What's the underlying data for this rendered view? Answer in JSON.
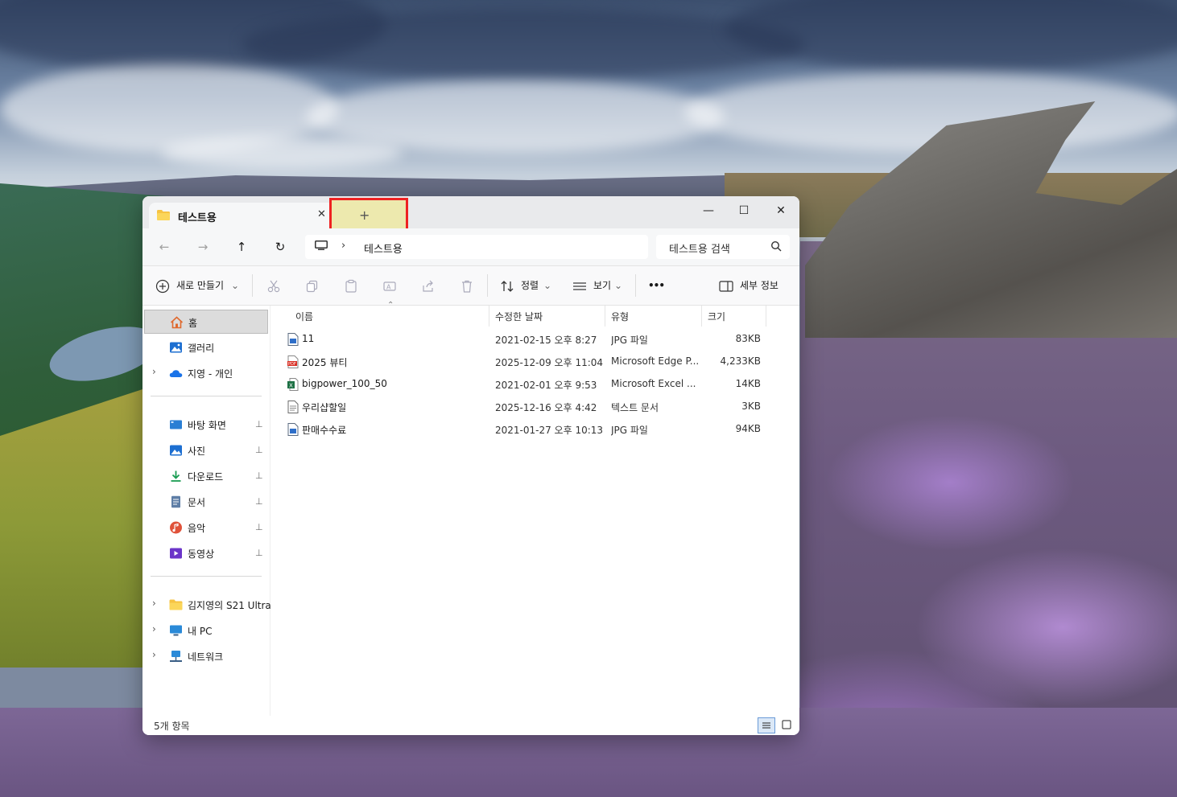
{
  "window": {
    "tab_title": "테스트용",
    "new_tab_label": "+",
    "close_tab_label": "✕",
    "minimize_label": "—",
    "maximize_label": "☐",
    "close_label": "✕"
  },
  "nav": {
    "back_label": "←",
    "forward_label": "→",
    "up_label": "↑",
    "refresh_label": "↻",
    "breadcrumb": "테스트용",
    "breadcrumb_separator": "›",
    "search_placeholder": "테스트용 검색"
  },
  "toolbar": {
    "new_label": "새로 만들기",
    "sort_label": "정렬",
    "view_label": "보기",
    "more_label": "•••",
    "details_label": "세부 정보",
    "chevron": "⌄"
  },
  "sidebar": {
    "items": [
      {
        "label": "홈",
        "icon": "home-icon"
      },
      {
        "label": "갤러리",
        "icon": "gallery-icon"
      },
      {
        "label": "지영 - 개인",
        "icon": "onedrive-icon"
      },
      {
        "label": "바탕 화면",
        "icon": "desktop-icon"
      },
      {
        "label": "사진",
        "icon": "pictures-icon"
      },
      {
        "label": "다운로드",
        "icon": "downloads-icon"
      },
      {
        "label": "문서",
        "icon": "documents-icon"
      },
      {
        "label": "음악",
        "icon": "music-icon"
      },
      {
        "label": "동영상",
        "icon": "videos-icon"
      },
      {
        "label": "김지영의 S21 Ultra",
        "icon": "folder-icon"
      },
      {
        "label": "내 PC",
        "icon": "this-pc-icon"
      },
      {
        "label": "네트워크",
        "icon": "network-icon"
      }
    ],
    "pin_glyph": "📌",
    "expand_glyph": "›"
  },
  "columns": {
    "name": "이름",
    "modified": "수정한 날짜",
    "type": "유형",
    "size": "크기"
  },
  "files": [
    {
      "name": "11",
      "modified": "2021-02-15 오후 8:27",
      "type": "JPG 파일",
      "size": "83KB",
      "icon": "jpg-file-icon"
    },
    {
      "name": "2025 뷰티",
      "modified": "2025-12-09 오후 11:04",
      "type": "Microsoft Edge P...",
      "size": "4,233KB",
      "icon": "pdf-file-icon"
    },
    {
      "name": "bigpower_100_50",
      "modified": "2021-02-01 오후 9:53",
      "type": "Microsoft Excel ...",
      "size": "14KB",
      "icon": "excel-file-icon"
    },
    {
      "name": "우리샵할일",
      "modified": "2025-12-16 오후 4:42",
      "type": "텍스트 문서",
      "size": "3KB",
      "icon": "text-file-icon"
    },
    {
      "name": "판매수수료",
      "modified": "2021-01-27 오후 10:13",
      "type": "JPG 파일",
      "size": "94KB",
      "icon": "jpg-file-icon"
    }
  ],
  "status": {
    "item_count": "5개 항목"
  },
  "colors": {
    "highlight_border": "#ee2222",
    "highlight_fill": "#ede9ae",
    "selected_item": "#dcdcdc"
  }
}
